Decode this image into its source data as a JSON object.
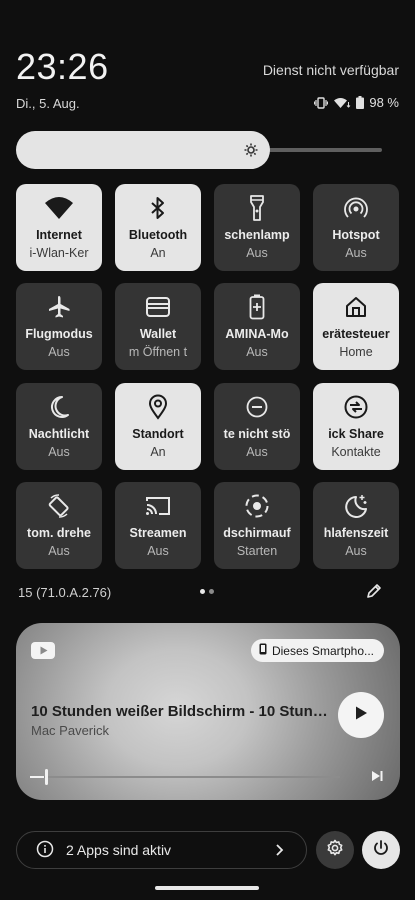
{
  "header": {
    "time": "23:26",
    "service": "Dienst nicht verfügbar",
    "date": "Di., 5. Aug.",
    "battery": "98 %"
  },
  "brightness": {
    "level": 0.63
  },
  "tiles": [
    {
      "title": "Internet",
      "subtitle": "i-Wlan-Ker",
      "icon": "wifi-icon",
      "on": true
    },
    {
      "title": "Bluetooth",
      "subtitle": "An",
      "icon": "bluetooth-icon",
      "on": true
    },
    {
      "title": "schenlamp",
      "subtitle": "Aus",
      "icon": "flashlight-icon",
      "on": false
    },
    {
      "title": "Hotspot",
      "subtitle": "Aus",
      "icon": "hotspot-icon",
      "on": false
    },
    {
      "title": "Flugmodus",
      "subtitle": "Aus",
      "icon": "airplane-icon",
      "on": false
    },
    {
      "title": "Wallet",
      "subtitle": "m Öffnen t",
      "icon": "wallet-icon",
      "on": false
    },
    {
      "title": "AMINA-Mo",
      "subtitle": "Aus",
      "icon": "battery-saver-icon",
      "on": false
    },
    {
      "title": "erätesteuer",
      "subtitle": "Home",
      "icon": "home-icon",
      "on": true
    },
    {
      "title": "Nachtlicht",
      "subtitle": "Aus",
      "icon": "moon-icon",
      "on": false
    },
    {
      "title": "Standort",
      "subtitle": "An",
      "icon": "location-icon",
      "on": true
    },
    {
      "title": "te nicht stö",
      "subtitle": "Aus",
      "icon": "do-not-disturb-icon",
      "on": false
    },
    {
      "title": "ick Share",
      "subtitle": "Kontakte",
      "icon": "quick-share-icon",
      "on": true
    },
    {
      "title": "tom. drehe",
      "subtitle": "Aus",
      "icon": "auto-rotate-icon",
      "on": false
    },
    {
      "title": "Streamen",
      "subtitle": "Aus",
      "icon": "cast-icon",
      "on": false
    },
    {
      "title": "dschirmauf",
      "subtitle": "Starten",
      "icon": "screen-record-icon",
      "on": false
    },
    {
      "title": "hlafenszeit",
      "subtitle": "Aus",
      "icon": "bedtime-icon",
      "on": false
    }
  ],
  "footer": {
    "version": "15 (71.0.A.2.76)",
    "page_count": 2,
    "active_page": 1
  },
  "media": {
    "output_device": "Dieses Smartpho...",
    "title": "10 Stunden weißer Bildschirm - 10 Stund...",
    "artist": "Mac Paverick",
    "progress": 0.01
  },
  "bottom": {
    "apps_active": "2 Apps sind aktiv"
  }
}
